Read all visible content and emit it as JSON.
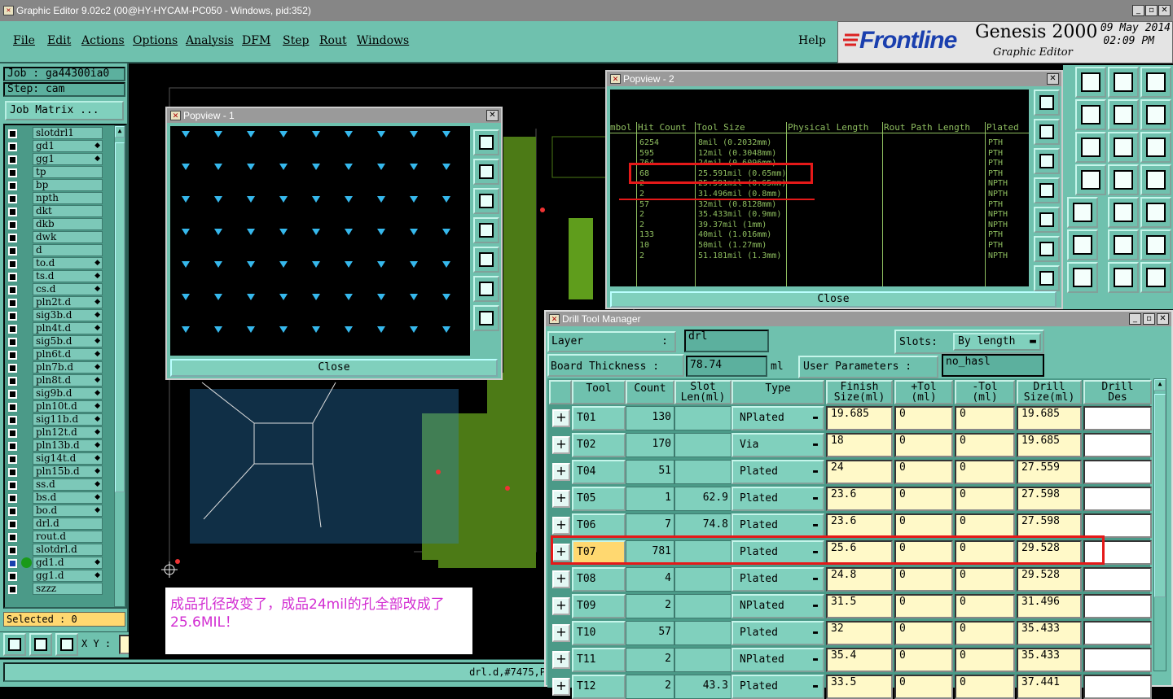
{
  "window": {
    "title": "Graphic Editor 9.02c2 (00@HY-HYCAM-PC050 - Windows, pid:352)"
  },
  "menu": [
    "File",
    "Edit",
    "Actions",
    "Options",
    "Analysis",
    "DFM",
    "Step",
    "Rout",
    "Windows"
  ],
  "help_label": "Help",
  "brand": {
    "logo": "Frontline",
    "product": "Genesis 2000",
    "subtitle": "Graphic Editor",
    "date": "09 May 2014",
    "time": "02:09 PM"
  },
  "job": {
    "job_label": "Job : ga44300ia0",
    "step_label": "Step: cam",
    "matrix_button": "Job Matrix ..."
  },
  "layers": [
    {
      "name": "slotdrl1",
      "arrow": false
    },
    {
      "name": "gd1",
      "arrow": true
    },
    {
      "name": "gg1",
      "arrow": true
    },
    {
      "name": "tp",
      "arrow": false
    },
    {
      "name": "bp",
      "arrow": false
    },
    {
      "name": "npth",
      "arrow": false
    },
    {
      "name": "dkt",
      "arrow": false
    },
    {
      "name": "dkb",
      "arrow": false
    },
    {
      "name": "dwk",
      "arrow": false
    },
    {
      "name": "d",
      "arrow": false
    },
    {
      "name": "to.d",
      "arrow": true
    },
    {
      "name": "ts.d",
      "arrow": true
    },
    {
      "name": "cs.d",
      "arrow": true
    },
    {
      "name": "pln2t.d",
      "arrow": true
    },
    {
      "name": "sig3b.d",
      "arrow": true
    },
    {
      "name": "pln4t.d",
      "arrow": true
    },
    {
      "name": "sig5b.d",
      "arrow": true
    },
    {
      "name": "pln6t.d",
      "arrow": true
    },
    {
      "name": "pln7b.d",
      "arrow": true
    },
    {
      "name": "pln8t.d",
      "arrow": true
    },
    {
      "name": "sig9b.d",
      "arrow": true
    },
    {
      "name": "pln10t.d",
      "arrow": true
    },
    {
      "name": "sig11b.d",
      "arrow": true
    },
    {
      "name": "pln12t.d",
      "arrow": true
    },
    {
      "name": "pln13b.d",
      "arrow": true
    },
    {
      "name": "sig14t.d",
      "arrow": true
    },
    {
      "name": "pln15b.d",
      "arrow": true
    },
    {
      "name": "ss.d",
      "arrow": true
    },
    {
      "name": "bs.d",
      "arrow": true
    },
    {
      "name": "bo.d",
      "arrow": true
    },
    {
      "name": "drl.d",
      "arrow": false
    },
    {
      "name": "rout.d",
      "arrow": false
    },
    {
      "name": "slotdrl.d",
      "arrow": false
    },
    {
      "name": "gd1.d",
      "arrow": true
    },
    {
      "name": "gg1.d",
      "arrow": true
    },
    {
      "name": "szzz",
      "arrow": false
    }
  ],
  "selected_label": "Selected : 0",
  "xy_label": "X Y :",
  "status_text": "drl.d,#7475,P",
  "note": "成品孔径改变了，成品24mil的孔全部改成了25.6MIL！",
  "popview1": {
    "title": "Popview - 1",
    "close": "Close"
  },
  "popview2": {
    "title": "Popview - 2",
    "close": "Close",
    "headers": [
      "mbol",
      "Hit Count",
      "Tool Size",
      "Physical Length",
      "Rout Path Length",
      "Plated"
    ],
    "rows": [
      [
        "",
        "6254",
        "8mil (0.2032mm)",
        "",
        "",
        "PTH"
      ],
      [
        "",
        "595",
        "12mil (0.3048mm)",
        "",
        "",
        "PTH"
      ],
      [
        "",
        "764",
        "24mil (0.6096mm)",
        "",
        "",
        "PTH"
      ],
      [
        "",
        "68",
        "25.591mil (0.65mm)",
        "",
        "",
        "PTH"
      ],
      [
        "",
        "2",
        "25.591mil (0.65mm)",
        "",
        "",
        "NPTH"
      ],
      [
        "",
        "2",
        "31.496mil (0.8mm)",
        "",
        "",
        "NPTH"
      ],
      [
        "",
        "57",
        "32mil (0.8128mm)",
        "",
        "",
        "PTH"
      ],
      [
        "",
        "2",
        "35.433mil (0.9mm)",
        "",
        "",
        "NPTH"
      ],
      [
        "",
        "2",
        "39.37mil (1mm)",
        "",
        "",
        "NPTH"
      ],
      [
        "",
        "133",
        "40mil (1.016mm)",
        "",
        "",
        "PTH"
      ],
      [
        "",
        "10",
        "50mil (1.27mm)",
        "",
        "",
        "PTH"
      ],
      [
        "",
        "2",
        "51.181mil (1.3mm)",
        "",
        "",
        "NPTH"
      ]
    ]
  },
  "dtm": {
    "title": "Drill Tool Manager",
    "layer_label": "Layer",
    "layer_colon": ":",
    "layer_value": "drl",
    "slots_label": "Slots:",
    "slots_value": "By length",
    "board_label": "Board Thickness :",
    "board_value": "78.74",
    "board_unit": "ml",
    "user_params_label": "User Parameters :",
    "user_params_value": "no_hasl",
    "columns": [
      "Tool",
      "Count",
      "Slot\nLen(ml)",
      "Type",
      "Finish\nSize(ml)",
      "+Tol\n(ml)",
      "-Tol\n(ml)",
      "Drill\nSize(ml)",
      "Drill\nDes"
    ],
    "rows": [
      {
        "tool": "T01",
        "count": "130",
        "slot": "",
        "type": "NPlated",
        "finish": "19.685",
        "ptol": "0",
        "mtol": "0",
        "drill": "19.685"
      },
      {
        "tool": "T02",
        "count": "170",
        "slot": "",
        "type": "Via",
        "finish": "18",
        "ptol": "0",
        "mtol": "0",
        "drill": "19.685"
      },
      {
        "tool": "T04",
        "count": "51",
        "slot": "",
        "type": "Plated",
        "finish": "24",
        "ptol": "0",
        "mtol": "0",
        "drill": "27.559"
      },
      {
        "tool": "T05",
        "count": "1",
        "slot": "62.9",
        "type": "Plated",
        "finish": "23.6",
        "ptol": "0",
        "mtol": "0",
        "drill": "27.598"
      },
      {
        "tool": "T06",
        "count": "7",
        "slot": "74.8",
        "type": "Plated",
        "finish": "23.6",
        "ptol": "0",
        "mtol": "0",
        "drill": "27.598"
      },
      {
        "tool": "T07",
        "count": "781",
        "slot": "",
        "type": "Plated",
        "finish": "25.6",
        "ptol": "0",
        "mtol": "0",
        "drill": "29.528"
      },
      {
        "tool": "T08",
        "count": "4",
        "slot": "",
        "type": "Plated",
        "finish": "24.8",
        "ptol": "0",
        "mtol": "0",
        "drill": "29.528"
      },
      {
        "tool": "T09",
        "count": "2",
        "slot": "",
        "type": "NPlated",
        "finish": "31.5",
        "ptol": "0",
        "mtol": "0",
        "drill": "31.496"
      },
      {
        "tool": "T10",
        "count": "57",
        "slot": "",
        "type": "Plated",
        "finish": "32",
        "ptol": "0",
        "mtol": "0",
        "drill": "35.433"
      },
      {
        "tool": "T11",
        "count": "2",
        "slot": "",
        "type": "NPlated",
        "finish": "35.4",
        "ptol": "0",
        "mtol": "0",
        "drill": "35.433"
      },
      {
        "tool": "T12",
        "count": "2",
        "slot": "43.3",
        "type": "Plated",
        "finish": "33.5",
        "ptol": "0",
        "mtol": "0",
        "drill": "37.441"
      }
    ]
  }
}
